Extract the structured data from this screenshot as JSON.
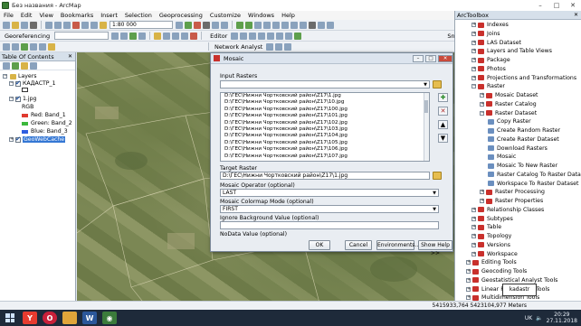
{
  "window": {
    "title": "Без названия - ArcMap"
  },
  "menu": [
    "File",
    "Edit",
    "View",
    "Bookmarks",
    "Insert",
    "Selection",
    "Geoprocessing",
    "Customize",
    "Windows",
    "Help"
  ],
  "toolbar": {
    "scale": "1:80 000",
    "georeferencing_label": "Georeferencing",
    "editor_label": "Editor",
    "network_analyst_label": "Network Analyst",
    "snapping_label": "Snapping"
  },
  "toc": {
    "title": "Table Of Contents",
    "layers_label": "Layers",
    "items": [
      {
        "label": "КАДАСТР_1",
        "checked": true
      },
      {
        "label": "1.jpg",
        "checked": true
      },
      {
        "label": "RGB"
      },
      {
        "label": "Red: Band_1",
        "color": "#e03a2f"
      },
      {
        "label": "Green: Band_2",
        "color": "#3cb83c"
      },
      {
        "label": "Blue: Band_3",
        "color": "#2f5fe0"
      },
      {
        "label": "GeoWebCache",
        "checked": true,
        "selected": true
      }
    ]
  },
  "dialog": {
    "title": "Mosaic",
    "input_rasters_label": "Input Rasters",
    "input_rasters": [
      "D:\\ГЕС\\Нижни Чортковский район\\Z17\\1.jpg",
      "D:\\ГЕС\\Нижни Чортковский район\\Z17\\10.jpg",
      "D:\\ГЕС\\Нижни Чортковский район\\Z17\\100.jpg",
      "D:\\ГЕС\\Нижни Чортковский район\\Z17\\101.jpg",
      "D:\\ГЕС\\Нижни Чортковский район\\Z17\\102.jpg",
      "D:\\ГЕС\\Нижни Чортковский район\\Z17\\103.jpg",
      "D:\\ГЕС\\Нижни Чортковский район\\Z17\\104.jpg",
      "D:\\ГЕС\\Нижни Чортковский район\\Z17\\105.jpg",
      "D:\\ГЕС\\Нижни Чортковский район\\Z17\\106.jpg",
      "D:\\ГЕС\\Нижни Чортковский район\\Z17\\107.jpg"
    ],
    "target_raster_label": "Target Raster",
    "target_raster": "D:\\ГЕС\\Нижни Чортковский район\\Z17\\1.jpg",
    "mosaic_operator_label": "Mosaic Operator (optional)",
    "mosaic_operator": "LAST",
    "colormap_mode_label": "Mosaic Colormap Mode (optional)",
    "colormap_mode": "FIRST",
    "ignore_bg_label": "Ignore Background Value (optional)",
    "nodata_label": "NoData Value (optional)",
    "buttons": {
      "ok": "OK",
      "cancel": "Cancel",
      "environments": "Environments...",
      "show_help": "Show Help >>"
    }
  },
  "arctoolbox": {
    "title": "ArcToolbox",
    "items": [
      {
        "label": "Indexes",
        "kind": "toolset",
        "level": 1
      },
      {
        "label": "Joins",
        "kind": "toolset",
        "level": 1
      },
      {
        "label": "LAS Dataset",
        "kind": "toolset",
        "level": 1
      },
      {
        "label": "Layers and Table Views",
        "kind": "toolset",
        "level": 1
      },
      {
        "label": "Package",
        "kind": "toolset",
        "level": 1
      },
      {
        "label": "Photos",
        "kind": "toolset",
        "level": 1
      },
      {
        "label": "Projections and Transformations",
        "kind": "toolset",
        "level": 1
      },
      {
        "label": "Raster",
        "kind": "toolset",
        "level": 1,
        "expanded": true
      },
      {
        "label": "Mosaic Dataset",
        "kind": "toolset",
        "level": 2
      },
      {
        "label": "Raster Catalog",
        "kind": "toolset",
        "level": 2
      },
      {
        "label": "Raster Dataset",
        "kind": "toolset",
        "level": 2,
        "expanded": true
      },
      {
        "label": "Copy Raster",
        "kind": "tool",
        "level": 3
      },
      {
        "label": "Create Random Raster",
        "kind": "tool",
        "level": 3
      },
      {
        "label": "Create Raster Dataset",
        "kind": "tool",
        "level": 3
      },
      {
        "label": "Download Rasters",
        "kind": "tool",
        "level": 3
      },
      {
        "label": "Mosaic",
        "kind": "tool",
        "level": 3
      },
      {
        "label": "Mosaic To New Raster",
        "kind": "tool",
        "level": 3
      },
      {
        "label": "Raster Catalog To Raster Dataset",
        "kind": "tool",
        "level": 3
      },
      {
        "label": "Workspace To Raster Dataset",
        "kind": "tool",
        "level": 3
      },
      {
        "label": "Raster Processing",
        "kind": "toolset",
        "level": 2
      },
      {
        "label": "Raster Properties",
        "kind": "toolset",
        "level": 2
      },
      {
        "label": "Relationship Classes",
        "kind": "toolset",
        "level": 1
      },
      {
        "label": "Subtypes",
        "kind": "toolset",
        "level": 1
      },
      {
        "label": "Table",
        "kind": "toolset",
        "level": 1
      },
      {
        "label": "Topology",
        "kind": "toolset",
        "level": 1
      },
      {
        "label": "Versions",
        "kind": "toolset",
        "level": 1
      },
      {
        "label": "Workspace",
        "kind": "toolset",
        "level": 1
      },
      {
        "label": "Editing Tools",
        "kind": "toolbox",
        "level": 0
      },
      {
        "label": "Geocoding Tools",
        "kind": "toolbox",
        "level": 0
      },
      {
        "label": "Geostatistical Analyst Tools",
        "kind": "toolbox",
        "level": 0
      },
      {
        "label": "Linear Referencing Tools",
        "kind": "toolbox",
        "level": 0
      },
      {
        "label": "Multidimension Tools",
        "kind": "toolbox",
        "level": 0
      }
    ]
  },
  "overview_label": "kadastr",
  "status": {
    "coords": "5415933,764  5423104,977 Meters"
  },
  "taskbar": {
    "lang": "UK",
    "time": "20:29",
    "date": "27.11.2018"
  }
}
